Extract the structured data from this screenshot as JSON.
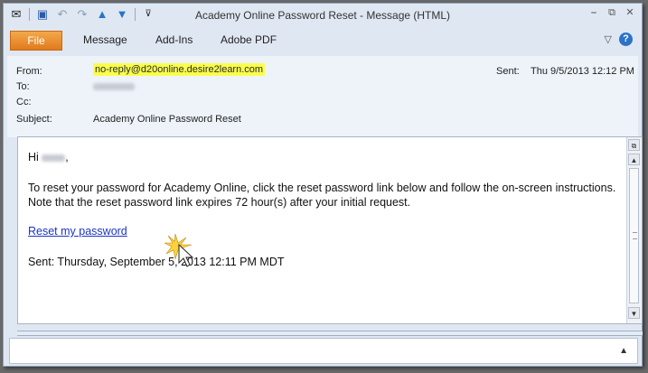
{
  "window": {
    "title": "Academy Online Password Reset  -  Message (HTML)",
    "controls": {
      "minimize": "⎯",
      "restore": "⧉",
      "close": "✕"
    }
  },
  "ribbon": {
    "tabs": [
      "File",
      "Message",
      "Add-Ins",
      "Adobe PDF"
    ]
  },
  "header": {
    "from_label": "From:",
    "from_value": "no-reply@d20online.desire2learn.com",
    "to_label": "To:",
    "cc_label": "Cc:",
    "subject_label": "Subject:",
    "subject_value": "Academy Online Password Reset",
    "sent_label": "Sent:",
    "sent_value": "Thu 9/5/2013 12:12 PM"
  },
  "message": {
    "greeting": "Hi",
    "greeting_punct": ",",
    "body": "To reset your password for Academy Online, click the reset password link below and follow the on-screen instructions. Note that the reset password link expires 72 hour(s) after your initial request.",
    "link": "Reset my password",
    "sent_line": "Sent: Thursday, September 5, 2013 12:11 PM MDT"
  },
  "colors": {
    "highlight": "#fafe4c",
    "link": "#1b34c4",
    "file_tab": "#e07a1c"
  }
}
